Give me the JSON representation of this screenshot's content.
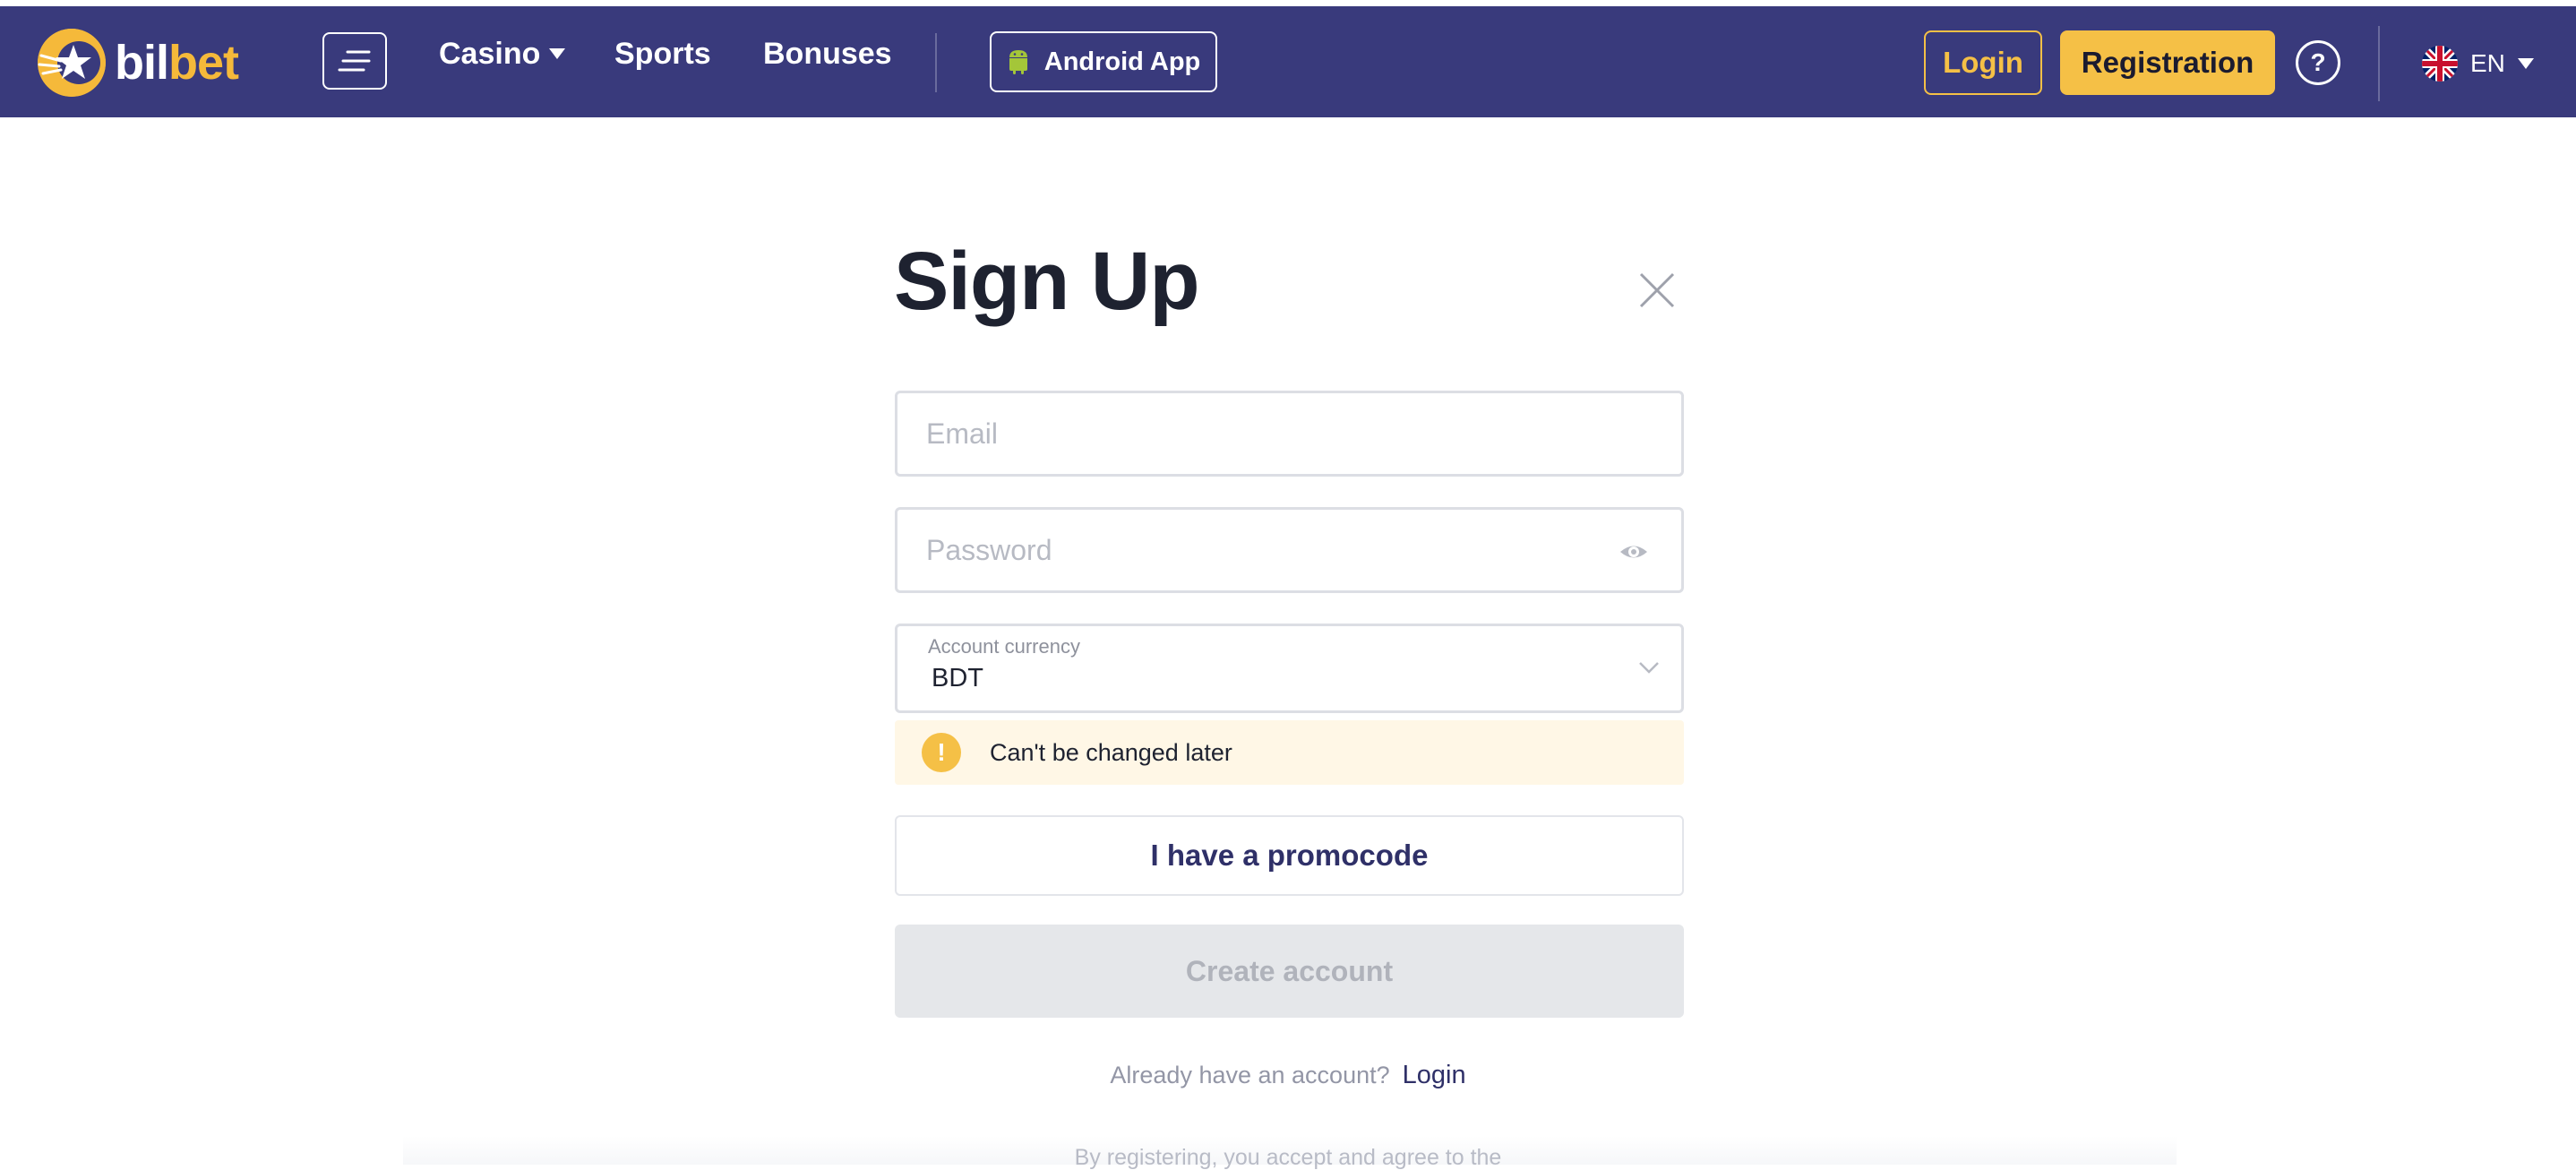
{
  "header": {
    "logo": {
      "part1": "bil",
      "part2": "bet"
    },
    "nav": [
      {
        "label": "Casino"
      },
      {
        "label": "Sports"
      },
      {
        "label": "Bonuses"
      }
    ],
    "android_label": "Android App",
    "login_label": "Login",
    "registration_label": "Registration",
    "help_label": "?",
    "language": "EN"
  },
  "form": {
    "title": "Sign Up",
    "email": {
      "placeholder": "Email",
      "value": ""
    },
    "password": {
      "placeholder": "Password",
      "value": ""
    },
    "currency": {
      "label": "Account currency",
      "value": "BDT"
    },
    "warning": {
      "icon": "!",
      "text": "Can't be changed later"
    },
    "promocode_label": "I have a promocode",
    "create_label": "Create account",
    "already_text": "Already have an account?",
    "login_link": "Login",
    "terms_text": "By registering, you accept and agree to the"
  },
  "colors": {
    "header_bg": "#393a7c",
    "accent_yellow": "#f5c046",
    "title_text": "#1e2230",
    "disabled_bg": "#e5e7ea"
  },
  "icons": {
    "logo": "bilbet-star-logo-icon",
    "menu": "hamburger-menu-icon",
    "android": "android-icon",
    "help": "question-mark-icon",
    "flag": "uk-flag-icon",
    "close": "close-icon",
    "eye": "eye-icon",
    "chevron": "chevron-down-icon",
    "warning": "warning-icon"
  }
}
